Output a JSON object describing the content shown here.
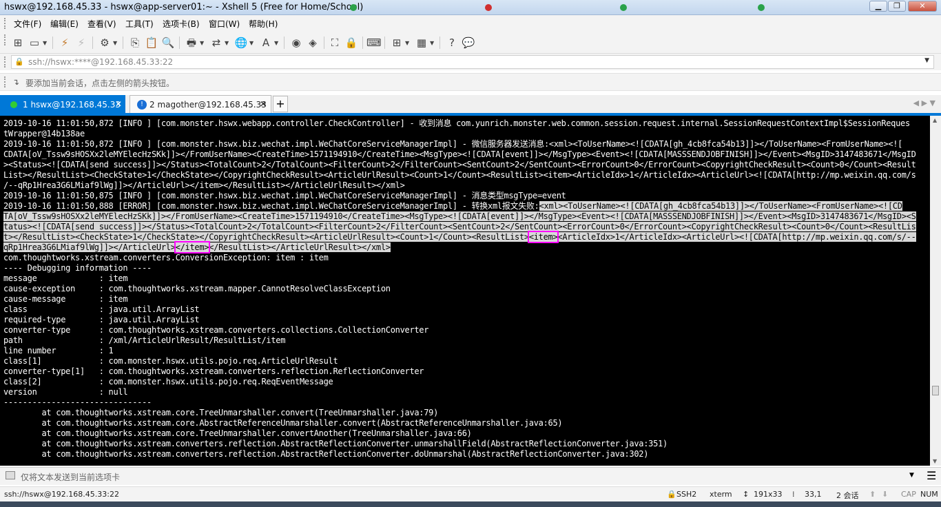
{
  "window": {
    "title": "hswx@192.168.45.33 - hswx@app-server01:~ - Xshell 5 (Free for Home/School)"
  },
  "menu": [
    "文件(F)",
    "编辑(E)",
    "查看(V)",
    "工具(T)",
    "选项卡(B)",
    "窗口(W)",
    "帮助(H)"
  ],
  "address": {
    "value": "ssh://hswx:****@192.168.45.33:22"
  },
  "session_hint": "要添加当前会话，点击左侧的箭头按钮。",
  "tabs": [
    {
      "label": "1 hswx@192.168.45.33",
      "status_color": "#33cc33",
      "active": true
    },
    {
      "label": "2 magother@192.168.45.33",
      "status_color": "#1a6fd6",
      "active": false
    }
  ],
  "terminal": {
    "lines": [
      "2019-10-16 11:01:50,872 [INFO ] [com.monster.hswx.webapp.controller.CheckController] - 收到消息 com.yunrich.monster.web.common.session.request.internal.SessionRequestContextImpl$SessionReques",
      "tWrapper@14b138ae",
      "2019-10-16 11:01:50,872 [INFO ] [com.monster.hswx.biz.wechat.impl.WeChatCoreServiceManagerImpl] - 微信服务器发送消息:<xml><ToUserName><![CDATA[gh_4cb8fca54b13]]></ToUserName><FromUserName><![",
      "CDATA[oV_Tssw9sHOSXx2leMYElecHzSKk]]></FromUserName><CreateTime>1571194910</CreateTime><MsgType><![CDATA[event]]></MsgType><Event><![CDATA[MASSSENDJOBFINISH]]></Event><MsgID>3147483671</MsgID",
      "><Status><![CDATA[send success]]></Status><TotalCount>2</TotalCount><FilterCount>2</FilterCount><SentCount>2</SentCount><ErrorCount>0</ErrorCount><CopyrightCheckResult><Count>0</Count><Result",
      "List></ResultList><CheckState>1</CheckState></CopyrightCheckResult><ArticleUrlResult><Count>1</Count><ResultList><item><ArticleIdx>1</ArticleIdx><ArticleUrl><![CDATA[http://mp.weixin.qq.com/s",
      "/--qRp1Hrea3G6LMiaf9lWg]]></ArticleUrl></item></ResultList></ArticleUrlResult></xml>",
      "2019-10-16 11:01:50,875 [INFO ] [com.monster.hswx.biz.wechat.impl.WeChatCoreServiceManagerImpl] - 消息类型msgType=event",
      "com.thoughtworks.xstream.converters.ConversionException: item : item",
      "---- Debugging information ----",
      "message             : item",
      "cause-exception     : com.thoughtworks.xstream.mapper.CannotResolveClassException",
      "cause-message       : item",
      "class               : java.util.ArrayList",
      "required-type       : java.util.ArrayList",
      "converter-type      : com.thoughtworks.xstream.converters.collections.CollectionConverter",
      "path                : /xml/ArticleUrlResult/ResultList/item",
      "line number         : 1",
      "class[1]            : com.monster.hswx.utils.pojo.req.ArticleUrlResult",
      "converter-type[1]   : com.thoughtworks.xstream.converters.reflection.ReflectionConverter",
      "class[2]            : com.monster.hswx.utils.pojo.req.ReqEventMessage",
      "version             : null",
      "-------------------------------",
      "        at com.thoughtworks.xstream.core.TreeUnmarshaller.convert(TreeUnmarshaller.java:79)",
      "        at com.thoughtworks.xstream.core.AbstractReferenceUnmarshaller.convert(AbstractReferenceUnmarshaller.java:65)",
      "        at com.thoughtworks.xstream.core.TreeUnmarshaller.convertAnother(TreeUnmarshaller.java:66)",
      "        at com.thoughtworks.xstream.converters.reflection.AbstractReflectionConverter.unmarshallField(AbstractReflectionConverter.java:351)",
      "        at com.thoughtworks.xstream.converters.reflection.AbstractReflectionConverter.doUnmarshal(AbstractReflectionConverter.java:302)"
    ],
    "error_block": {
      "l1_prefix": "2019-10-16 11:01:50,888 [ERROR] [com.monster.hswx.biz.wechat.impl.WeChatCoreServiceManagerImpl] - 转换xml报文失败:",
      "l1_sel": "<xml><ToUserName><![CDATA[gh_4cb8fca54b13]]></ToUserName><FromUserName><![CD",
      "l2_sel": "TA[oV_Tssw9sHOSXx2leMYElecHzSKk]]></FromUserName><CreateTime>1571194910</CreateTime><MsgType><![CDATA[event]]></MsgType><Event><![CDATA[MASSSENDJOBFINISH]]></Event><MsgID>3147483671</MsgID><S",
      "l3_sel": "tatus><![CDATA[send success]]></Status><TotalCount>2</TotalCount><FilterCount>2</FilterCount><SentCount>2</SentCount><ErrorCount>0</ErrorCount><CopyrightCheckResult><Count>0</Count><ResultLis",
      "l4_a": "t></ResultList><CheckState>1</CheckState></CopyrightCheckResult><ArticleUrlResult><Count>1</Count><ResultList>",
      "l4_hl": "<item>",
      "l4_b": "<ArticleIdx>1</ArticleIdx><ArticleUrl><![CDATA[http://mp.weixin.qq.com/s/--",
      "l5_a": "qRp1Hrea3G6LMiaf9lWg]]></ArticleUrl>",
      "l5_hl": "</item>",
      "l5_b": "</ResultList></ArticleUrlResult></xml>"
    }
  },
  "compose": {
    "placeholder": "仅将文本发送到当前选项卡"
  },
  "status": {
    "connection": "ssh://hswx@192.168.45.33:22",
    "protocol": "SSH2",
    "term": "xterm",
    "size": "191x33",
    "cursor": "33,1",
    "sessions": "2 会话",
    "caps": "CAP",
    "num": "NUM"
  }
}
